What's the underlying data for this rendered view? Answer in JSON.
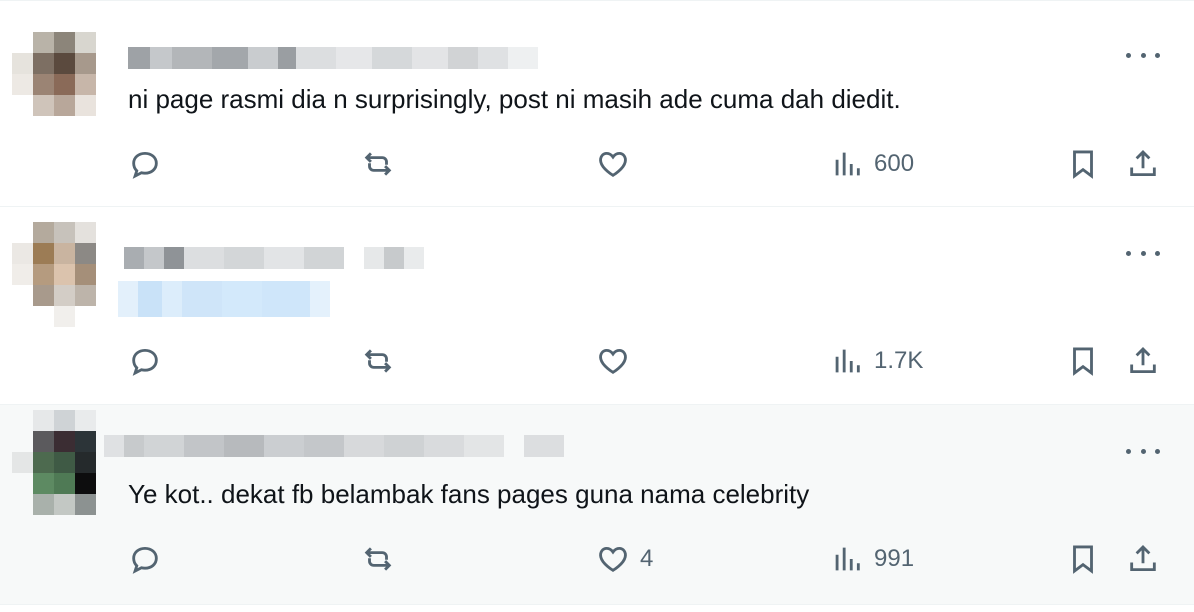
{
  "tweets": [
    {
      "text": "ni page rasmi dia n surprisingly, post ni masih ade cuma dah diedit.",
      "stats": {
        "replies": "",
        "retweets": "",
        "likes": "",
        "views": "600"
      }
    },
    {
      "text": "",
      "stats": {
        "replies": "",
        "retweets": "",
        "likes": "",
        "views": "1.7K"
      }
    },
    {
      "text": "Ye kot.. dekat fb belambak fans pages guna nama celebrity",
      "stats": {
        "replies": "",
        "retweets": "",
        "likes": "4",
        "views": "991"
      }
    }
  ],
  "icons": {
    "reply": "reply-icon",
    "retweet": "retweet-icon",
    "like": "heart-icon",
    "views": "views-icon",
    "bookmark": "bookmark-icon",
    "share": "share-icon",
    "more": "more-icon"
  },
  "colors": {
    "text": "#0f1419",
    "secondary": "#536471",
    "hover_bg": "#f7f9f9",
    "divider": "#eff3f4",
    "link_blur": "#d3e9fb"
  }
}
